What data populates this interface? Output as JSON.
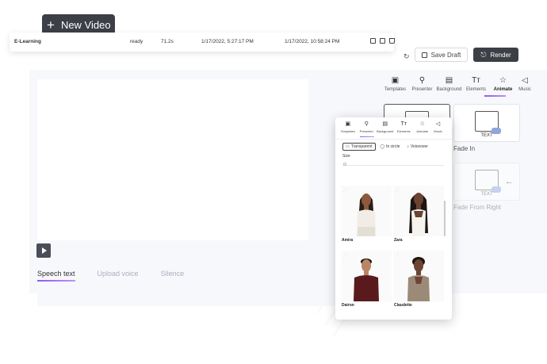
{
  "header": {
    "new_video_label": "New Video"
  },
  "video_row": {
    "name": "E-Learning",
    "status": "ready",
    "duration": "71.2s",
    "created": "1/17/2022, 5:27:17 PM",
    "updated": "1/17/2022, 10:58:24 PM"
  },
  "toolbar": {
    "save_label": "Save Draft",
    "render_label": "Render"
  },
  "tabs": [
    {
      "label": "Templates",
      "icon": "image-icon"
    },
    {
      "label": "Presenter",
      "icon": "person-icon"
    },
    {
      "label": "Background",
      "icon": "file-icon"
    },
    {
      "label": "Elements",
      "icon": "text-icon"
    },
    {
      "label": "Animate",
      "icon": "star-icon"
    },
    {
      "label": "Music",
      "icon": "speaker-icon"
    }
  ],
  "animations": {
    "card_text": "TEXT",
    "fade_in": "Fade In",
    "fade_from_right": "Fade From Right"
  },
  "speech": {
    "tabs": [
      "Speech text",
      "Upload voice",
      "Silence"
    ]
  },
  "presenter_popup": {
    "tabs": [
      "Templates",
      "Presenter",
      "Background",
      "Elements",
      "Animate",
      "Music"
    ],
    "options": [
      "Transparent",
      "In circle",
      "Voiceover"
    ],
    "size_label": "Size",
    "presenters": [
      "Amira",
      "Zara",
      "Dairon",
      "Claudette"
    ]
  },
  "colors": {
    "dark_button": "#3d3f46",
    "accent_start": "#8a5cf6",
    "accent_end": "#c48ef8"
  }
}
